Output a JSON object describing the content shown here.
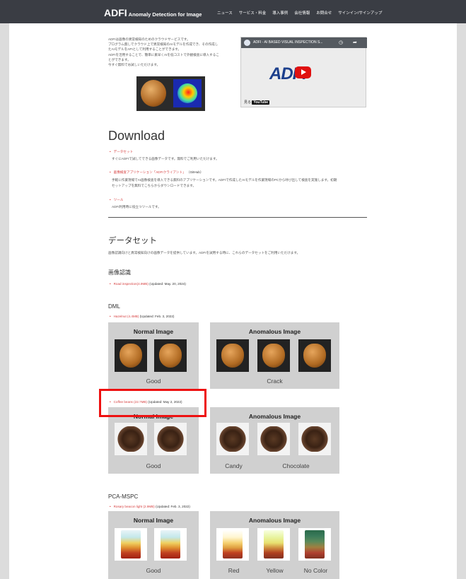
{
  "header": {
    "logo": "ADFI",
    "logo_sub": "Anomaly Detection for Image",
    "nav": [
      "ニュース",
      "サービス・料金",
      "導入事例",
      "会社情報",
      "お問合せ",
      "サインイン/サインアップ"
    ]
  },
  "intro": {
    "lines": [
      "ADFIは画像の異常検知のためのクラウドサービスです。",
      "プログラム無しでクラウド上で異常検知のAIモデルを作成でき、その作成し",
      "たAIモデルをAPIとして利用することができます。",
      "ADFIを活用することで、簡単に素早くAIを低コストで外観検査に導入するこ",
      "とができます。",
      "今すぐ無料でお試しいただけます。"
    ]
  },
  "video": {
    "title": "ADFI - AI BASED VISUAL INSPECTION S...",
    "brand": "ADFI",
    "watch_on": "見る",
    "youtube": "YouTube"
  },
  "download": {
    "heading": "Download",
    "items": [
      {
        "link": "データセット",
        "extra": "",
        "desc": [
          "すぐにADFIで試してできる画像データです。無料でご利用いただけます。"
        ]
      },
      {
        "link": "画像検査アプリケーション「ADFIクライアント」",
        "extra": "（GitHub）",
        "desc": [
          "手軽に作業現場でAI画像検査を導入できる無料のアプリケーションです。ADFIで作成したAIモデルを作業現場のPCから呼び出して検査を実施します。初期",
          "セットアップを無料でこちらからダウンロードできます。"
        ]
      },
      {
        "link": "ツール",
        "extra": "",
        "desc": [
          "ADFI利用時に役立つツールです。"
        ]
      }
    ]
  },
  "dataset": {
    "heading": "データセット",
    "desc": "画像認識向けと異常検知向けの画像データを提供しています。ADFIを試用する時に、これらのデータセットをご利用いただけます。",
    "recog": {
      "heading": "画像認識",
      "link": "Road inspection(4.9MB)",
      "updated": "(Updated: May. 20, 2024)"
    },
    "dml": {
      "heading": "DML",
      "hazelnut": {
        "link": "Hazelnut (4.4MB)",
        "updated": "(Updated: Feb. 3, 2022)",
        "normal_title": "Normal Image",
        "anomalous_title": "Anomalous Image",
        "normal_caption": "Good",
        "anomalous_caption": "Crack"
      },
      "coffee": {
        "link": "Coffee beans (22.7MB)",
        "updated": "(Updated: May 2, 2022)",
        "normal_title": "Normal Image",
        "anomalous_title": "Anomalous Image",
        "captions": [
          "Good",
          "Candy",
          "Chocolate"
        ]
      }
    },
    "pca": {
      "heading": "PCA-MSPC",
      "link": "Rosary beacon light (2.9MB)",
      "updated": "(Updated: Feb. 3, 2022)",
      "normal_title": "Normal Image",
      "anomalous_title": "Anomalous Image",
      "captions": [
        "Good",
        "Red",
        "Yellow",
        "No Color"
      ]
    }
  },
  "colors": {
    "topbar": "#3a3d44",
    "link": "#d64040",
    "highlight": "#ee1111",
    "panel": "#d0d0d0"
  }
}
